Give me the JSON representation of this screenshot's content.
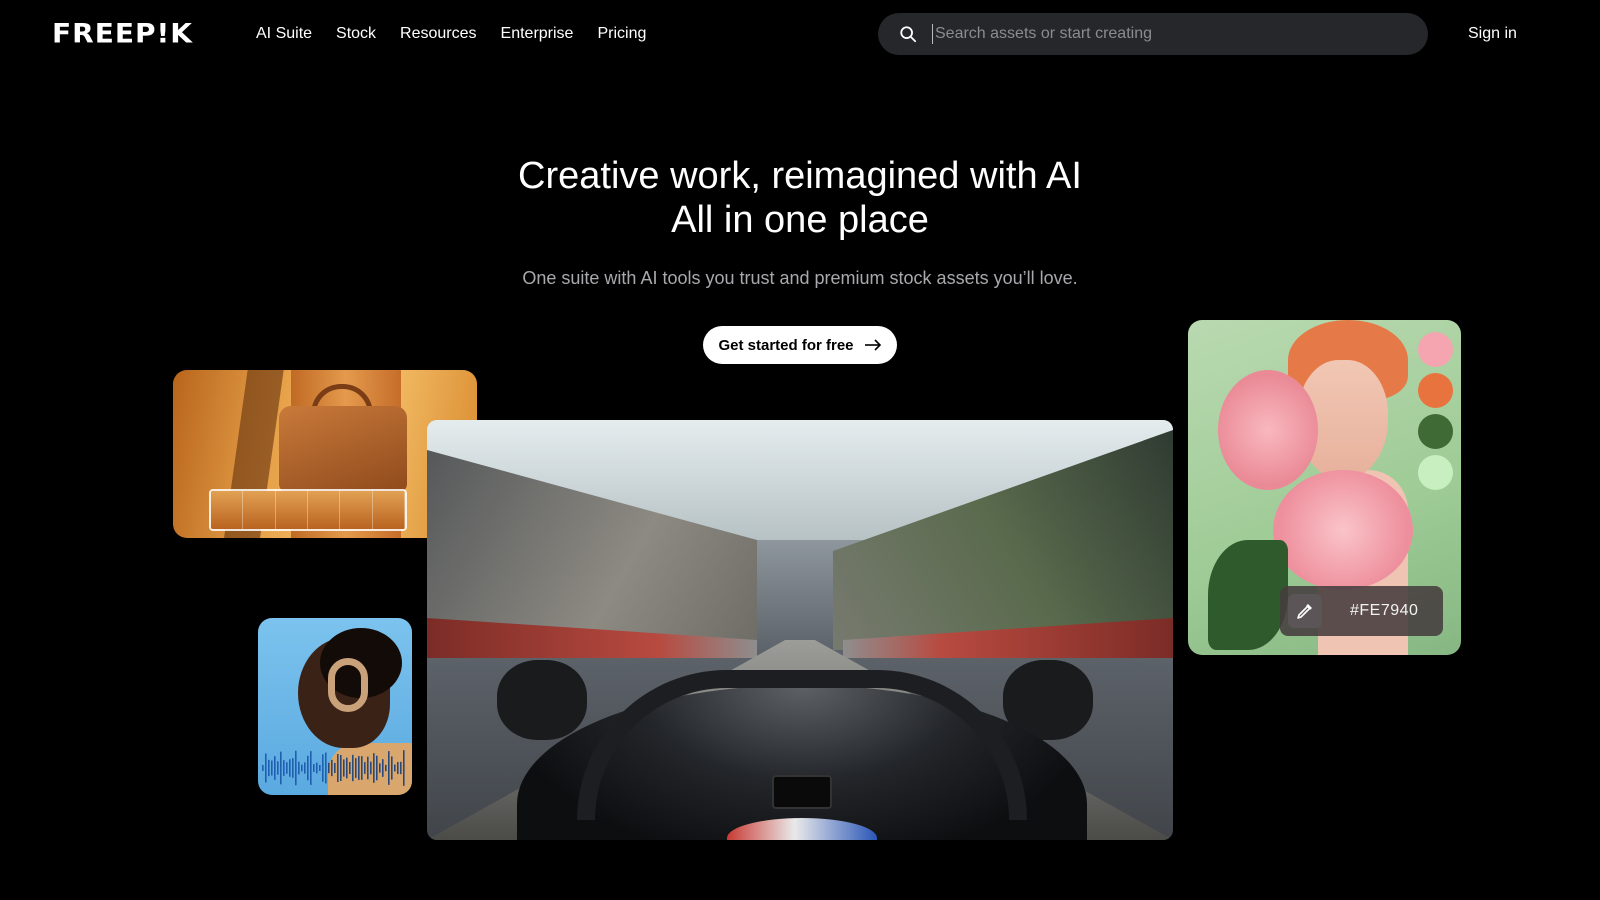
{
  "header": {
    "logo": "FREEP!K",
    "nav": [
      "AI Suite",
      "Stock",
      "Resources",
      "Enterprise",
      "Pricing"
    ],
    "search": {
      "placeholder": "Search assets or start creating",
      "value": ""
    },
    "signin": "Sign in"
  },
  "hero": {
    "title_line1": "Creative work, reimagined with AI",
    "title_line2": "All in one place",
    "subtitle": "One suite with AI tools you trust and premium stock assets you’ll love.",
    "cta": "Get started for free"
  },
  "showcase": {
    "color_picker": {
      "hex": "#FE7940",
      "swatches": [
        "#f4a5b0",
        "#e9733f",
        "#3f6a35",
        "#c7efc0"
      ]
    }
  }
}
